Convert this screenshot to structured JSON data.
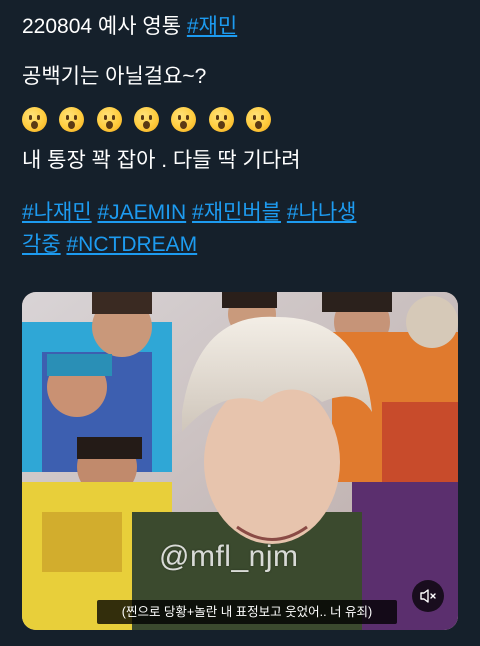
{
  "tweet": {
    "line1_text": "220804 예사 영통 ",
    "line1_hashtag": "#재민",
    "line2": "공백기는 아닐걸요~?",
    "emoji_icon": "hushed-face",
    "emoji_count": 7,
    "line4": "내 통장 꽉 잡아 . 다들 딱 기다려",
    "hashtags": [
      "#나재민",
      "#JAEMIN",
      "#재민버블",
      "#나나생각중",
      "#NCTDREAM"
    ],
    "hashtag_color": "#1d9bf0"
  },
  "media": {
    "watermark": "@mfl_njm",
    "subtitle": "(찐으로 당황+놀란 내 표정보고 웃었어.. 너 유죄)",
    "mute_icon": "speaker-muted-icon"
  },
  "background_color": "#15202b"
}
